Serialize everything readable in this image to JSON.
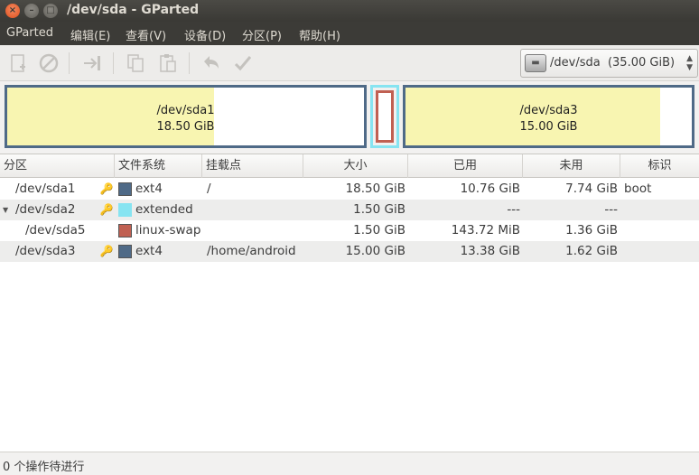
{
  "window": {
    "title": "/dev/sda - GParted"
  },
  "menu": [
    "GParted",
    "编辑(E)",
    "查看(V)",
    "设备(D)",
    "分区(P)",
    "帮助(H)"
  ],
  "toolbar": {
    "icons": [
      "new-partition-icon",
      "delete-icon",
      "resize-move-icon",
      "copy-icon",
      "paste-icon",
      "undo-icon",
      "apply-icon"
    ]
  },
  "device_selector": {
    "label": "/dev/sda  (35.00 GiB)"
  },
  "partition_map": [
    {
      "name": "/dev/sda1",
      "size": "18.50 GiB",
      "used_fraction": 0.58
    },
    {
      "name": "/dev/sda2",
      "type": "extended"
    },
    {
      "name": "/dev/sda3",
      "size": "15.00 GiB",
      "used_fraction": 0.89
    }
  ],
  "table": {
    "columns": [
      "分区",
      "文件系统",
      "挂载点",
      "大小",
      "已用",
      "未用",
      "标识"
    ],
    "rows": [
      {
        "partition": "/dev/sda1",
        "fs": "ext4",
        "fs_color": "#4f6a87",
        "mount": "/",
        "size": "18.50 GiB",
        "used": "10.76 GiB",
        "unused": "7.74 GiB",
        "flags": "boot",
        "indent": 0,
        "expander": ""
      },
      {
        "partition": "/dev/sda2",
        "fs": "extended",
        "fs_color": "#87e4f1",
        "mount": "",
        "size": "1.50 GiB",
        "used": "---",
        "unused": "---",
        "flags": "",
        "indent": 0,
        "expander": "▼"
      },
      {
        "partition": "/dev/sda5",
        "fs": "linux-swap",
        "fs_color": "#c06052",
        "mount": "",
        "size": "1.50 GiB",
        "used": "143.72 MiB",
        "unused": "1.36 GiB",
        "flags": "",
        "indent": 1,
        "expander": ""
      },
      {
        "partition": "/dev/sda3",
        "fs": "ext4",
        "fs_color": "#4f6a87",
        "mount": "/home/android",
        "size": "15.00 GiB",
        "used": "13.38 GiB",
        "unused": "1.62 GiB",
        "flags": "",
        "indent": 0,
        "expander": ""
      }
    ]
  },
  "status": {
    "text": "0 个操作待进行"
  },
  "colors": {
    "ext4": "#4f6a87",
    "extended": "#87e4f1",
    "linux_swap": "#c06052",
    "used_space": "#f8f5b1"
  }
}
